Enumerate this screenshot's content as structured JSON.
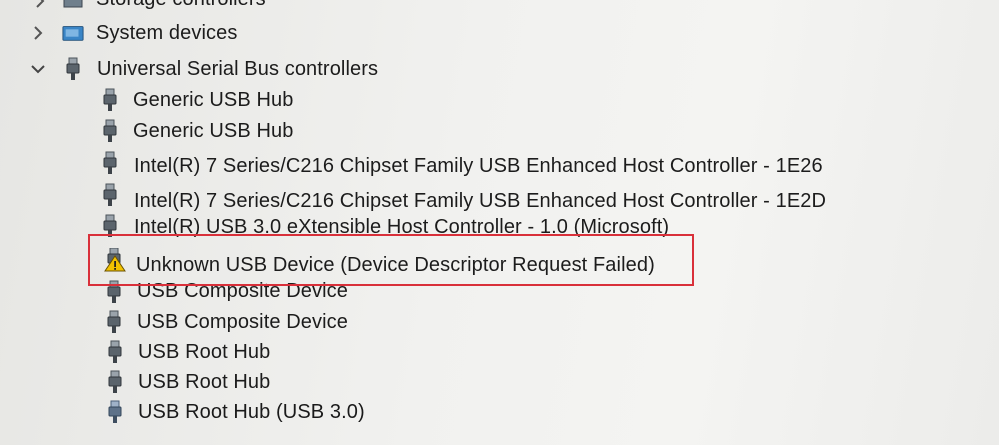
{
  "tree": {
    "categories": [
      {
        "label": "Storage controllers",
        "expanded": false
      },
      {
        "label": "System devices",
        "expanded": false
      },
      {
        "label": "Universal Serial Bus controllers",
        "expanded": true
      }
    ],
    "usb_devices": [
      {
        "label": "Generic USB Hub",
        "status": "ok"
      },
      {
        "label": "Generic USB Hub",
        "status": "ok"
      },
      {
        "label": "Intel(R) 7 Series/C216 Chipset Family USB Enhanced Host Controller - 1E26",
        "status": "ok"
      },
      {
        "label": "Intel(R) 7 Series/C216 Chipset Family USB Enhanced Host Controller - 1E2D",
        "status": "ok"
      },
      {
        "label": "Intel(R) USB 3.0 eXtensible Host Controller - 1.0 (Microsoft)",
        "status": "ok"
      },
      {
        "label": "Unknown USB Device (Device Descriptor Request Failed)",
        "status": "warning"
      },
      {
        "label": "USB Composite Device",
        "status": "ok"
      },
      {
        "label": "USB Composite Device",
        "status": "ok"
      },
      {
        "label": "USB Root Hub",
        "status": "ok"
      },
      {
        "label": "USB Root Hub",
        "status": "ok"
      },
      {
        "label": "USB Root Hub (USB 3.0)",
        "status": "ok"
      }
    ]
  },
  "colors": {
    "highlight_border": "#d9303a",
    "warning_icon": "#f2c200"
  },
  "icons": {
    "collapsed": "chevron-right-icon",
    "expanded": "chevron-down-icon",
    "usb_device": "usb-plug-icon",
    "warning_device": "warning-triangle-icon",
    "system_devices": "computer-folder-icon"
  }
}
